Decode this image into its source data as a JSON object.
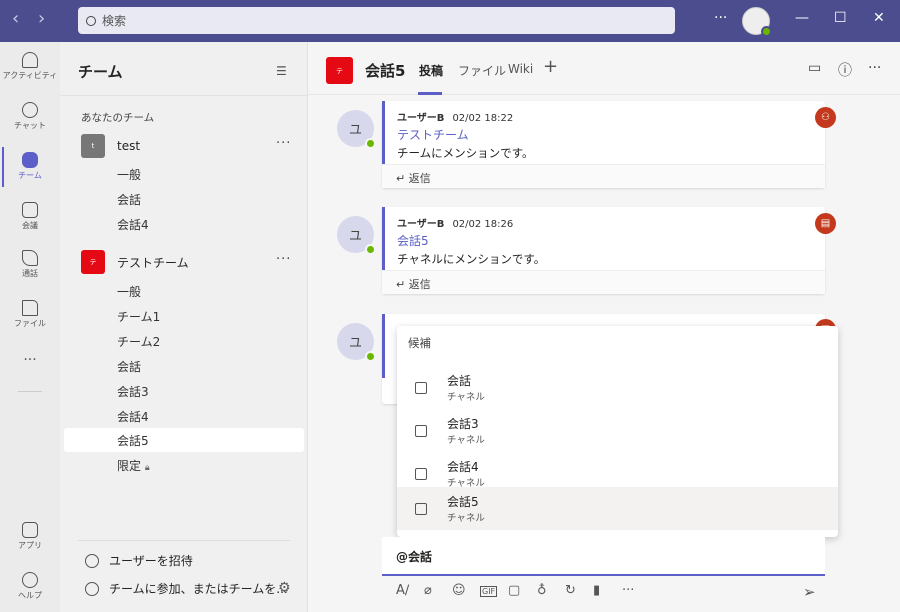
{
  "topbar": {
    "search_placeholder": "検索",
    "more": "···",
    "minimize": "—",
    "maximize": "☐",
    "close": "✕",
    "back": "‹",
    "forward": "›"
  },
  "rail": [
    {
      "label": "アクティビティ"
    },
    {
      "label": "チャット"
    },
    {
      "label": "チーム"
    },
    {
      "label": "会議"
    },
    {
      "label": "通話"
    },
    {
      "label": "ファイル"
    },
    {
      "label": "···"
    },
    {
      "label": "アプリ"
    },
    {
      "label": "ヘルプ"
    }
  ],
  "panel": {
    "title": "チーム",
    "section": "あなたのチーム",
    "teams": [
      {
        "name": "test",
        "initial": "t",
        "color": "#777777",
        "channels": [
          "一般",
          "会話",
          "会話4"
        ]
      },
      {
        "name": "テストチーム",
        "initial": "テ",
        "color": "#e50914",
        "channels": [
          "一般",
          "チーム1",
          "チーム2",
          "会話",
          "会話3",
          "会話4",
          "会話5",
          "限定"
        ]
      }
    ],
    "invite": "ユーザーを招待",
    "join": "チームに参加、またはチームを..."
  },
  "header": {
    "initial": "テ",
    "channel": "会話5",
    "tabs": [
      "投稿",
      "ファイル",
      "Wiki"
    ],
    "add": "+"
  },
  "messages": [
    {
      "avatar": "ユ",
      "author": "ユーザーB",
      "time": "02/02 18:22",
      "mention": "テストチーム",
      "text": "チームにメンションです。",
      "reply": "返信"
    },
    {
      "avatar": "ユ",
      "author": "ユーザーB",
      "time": "02/02 18:26",
      "mention": "会話5",
      "text": "チャネルにメンションです。",
      "reply": "返信"
    },
    {
      "avatar": "ユ"
    }
  ],
  "popup": {
    "title": "候補",
    "items": [
      {
        "name": "会話",
        "type": "チャネル"
      },
      {
        "name": "会話3",
        "type": "チャネル"
      },
      {
        "name": "会話4",
        "type": "チャネル"
      },
      {
        "name": "会話5",
        "type": "チャネル"
      }
    ]
  },
  "compose": {
    "value": "@会話",
    "more": "···"
  },
  "colors": {
    "accent": "#5b5fc7",
    "topbar": "#4b4d8f",
    "badge": "#c4391d"
  }
}
